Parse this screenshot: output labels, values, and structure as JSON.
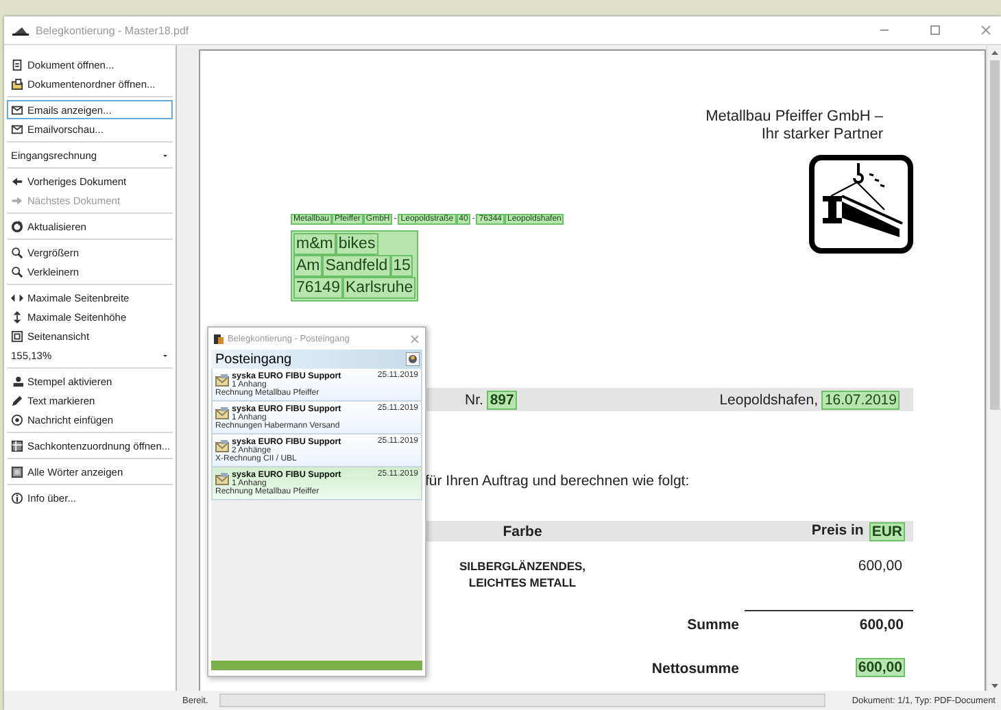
{
  "window": {
    "title": "Belegkontierung - Master18.pdf"
  },
  "sidebar": {
    "groups": [
      [
        {
          "kind": "button",
          "label": "Dokument öffnen...",
          "selected": false,
          "disabled": false
        },
        {
          "kind": "button",
          "label": "Dokumentenordner öffnen...",
          "selected": false,
          "disabled": false
        }
      ],
      [
        {
          "kind": "button",
          "label": "Emails anzeigen...",
          "selected": true,
          "disabled": false
        },
        {
          "kind": "button",
          "label": "Emailvorschau...",
          "selected": false,
          "disabled": false
        }
      ],
      [
        {
          "kind": "dropdown",
          "value": "Eingangsrechnung"
        }
      ],
      [
        {
          "kind": "button",
          "label": "Vorheriges Dokument",
          "selected": false,
          "disabled": false
        },
        {
          "kind": "button",
          "label": "Nächstes Dokument",
          "selected": false,
          "disabled": true
        }
      ],
      [
        {
          "kind": "button",
          "label": "Aktualisieren",
          "selected": false,
          "disabled": false
        }
      ],
      [
        {
          "kind": "button",
          "label": "Vergrößern",
          "selected": false,
          "disabled": false
        },
        {
          "kind": "button",
          "label": "Verkleinern",
          "selected": false,
          "disabled": false
        }
      ],
      [
        {
          "kind": "button",
          "label": "Maximale Seitenbreite",
          "selected": false,
          "disabled": false
        },
        {
          "kind": "button",
          "label": "Maximale Seitenhöhe",
          "selected": false,
          "disabled": false
        },
        {
          "kind": "button",
          "label": "Seitenansicht",
          "selected": false,
          "disabled": false
        },
        {
          "kind": "dropdown",
          "value": "155,13%"
        }
      ],
      [
        {
          "kind": "button",
          "label": "Stempel aktivieren",
          "selected": false,
          "disabled": false
        },
        {
          "kind": "button",
          "label": "Text markieren",
          "selected": false,
          "disabled": false
        },
        {
          "kind": "button",
          "label": "Nachricht einfügen",
          "selected": false,
          "disabled": false
        }
      ],
      [
        {
          "kind": "button",
          "label": "Sachkontenzuordnung öffnen...",
          "selected": false,
          "disabled": false
        }
      ],
      [
        {
          "kind": "button",
          "label": "Alle Wörter anzeigen",
          "selected": false,
          "disabled": false
        }
      ],
      [
        {
          "kind": "button",
          "label": "Info über...",
          "selected": false,
          "disabled": false
        }
      ]
    ]
  },
  "document": {
    "letterhead": [
      "Metallbau Pfeiffer GmbH –",
      "Ihr starker Partner"
    ],
    "sender_line": [
      {
        "text": "Metallbau",
        "highlighted": true
      },
      {
        "text": "Pfeiffer",
        "highlighted": true
      },
      {
        "text": "GmbH",
        "highlighted": true
      },
      {
        "text": "-",
        "highlighted": false
      },
      {
        "text": "Leopoldstraße",
        "highlighted": true
      },
      {
        "text": "40",
        "highlighted": true
      },
      {
        "text": "-",
        "highlighted": false
      },
      {
        "text": "76344",
        "highlighted": true
      },
      {
        "text": "Leopoldshafen",
        "highlighted": true
      }
    ],
    "recipient": [
      [
        {
          "text": "m&m",
          "highlighted": true
        },
        {
          "text": "bikes",
          "highlighted": true
        }
      ],
      [
        {
          "text": "Am",
          "highlighted": true
        },
        {
          "text": "Sandfeld",
          "highlighted": true
        },
        {
          "text": "15",
          "highlighted": true
        }
      ],
      [
        {
          "text": "76149",
          "highlighted": true
        },
        {
          "text": "Karlsruhe",
          "highlighted": true
        }
      ]
    ],
    "reference_row": {
      "number_label": "Nr.",
      "number": {
        "text": "897",
        "highlighted": true
      },
      "place": "Leopoldshafen,",
      "date": {
        "text": "16.07.2019",
        "highlighted": true
      }
    },
    "intro": "für Ihren Auftrag und berechnen wie folgt:",
    "table": {
      "columns": [
        [
          {
            "text": "Farbe",
            "highlighted": false
          }
        ],
        [
          {
            "text": "Preis in",
            "highlighted": false
          },
          {
            "text": "EUR",
            "highlighted": true
          }
        ]
      ],
      "rows": [
        {
          "description": "SILBERGLÄNZENDES, LEICHTES METALL",
          "price": "600,00"
        }
      ]
    },
    "totals": [
      {
        "label": "Summe",
        "value": {
          "text": "600,00",
          "highlighted": false
        },
        "rule": true
      },
      {
        "label": "Nettosumme",
        "value": {
          "text": "600,00",
          "highlighted": true
        },
        "rule": false
      }
    ]
  },
  "inbox_window": {
    "title": "Belegkontierung - Posteingang",
    "header": "Posteingang",
    "messages": [
      {
        "sender": "syska EURO FIBU Support",
        "date": "25.11.2019",
        "attachments": "1 Anhang",
        "subject": "Rechnung Metallbau Pfeiffer",
        "selected": false
      },
      {
        "sender": "syska EURO FIBU Support",
        "date": "25.11.2019",
        "attachments": "1 Anhang",
        "subject": "Rechnungen Habermann Versand",
        "selected": false
      },
      {
        "sender": "syska EURO FIBU Support",
        "date": "25.11.2019",
        "attachments": "2 Anhänge",
        "subject": "X-Rechnung CII / UBL",
        "selected": false
      },
      {
        "sender": "syska EURO FIBU Support",
        "date": "25.11.2019",
        "attachments": "1 Anhang",
        "subject": "Rechnung Metallbau Pfeiffer",
        "selected": true
      }
    ],
    "progress": {
      "level": 1
    }
  },
  "status_bar": {
    "text": "Bereit.",
    "progress": {
      "level": 0
    },
    "info": "Dokument: 1/1, Typ: PDF-Document"
  }
}
